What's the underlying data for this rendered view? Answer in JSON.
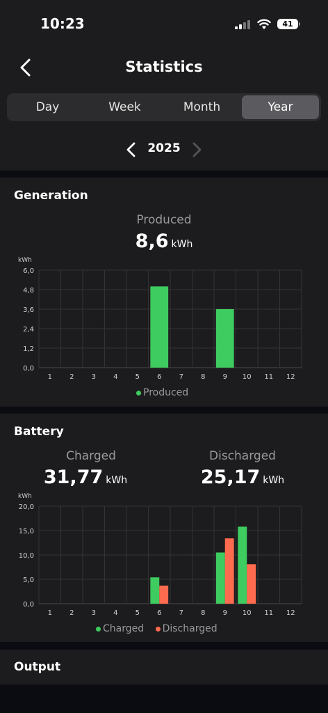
{
  "status_bar": {
    "time": "10:23",
    "battery": "41"
  },
  "header": {
    "title": "Statistics"
  },
  "tabs": [
    {
      "label": "Day",
      "active": false
    },
    {
      "label": "Week",
      "active": false
    },
    {
      "label": "Month",
      "active": false
    },
    {
      "label": "Year",
      "active": true
    }
  ],
  "period": {
    "label": "2025"
  },
  "generation": {
    "title": "Generation",
    "stat_label": "Produced",
    "stat_value": "8,6",
    "stat_unit": "kWh",
    "legend": "Produced"
  },
  "battery": {
    "title": "Battery",
    "charged_label": "Charged",
    "charged_value": "31,77",
    "charged_unit": "kWh",
    "discharged_label": "Discharged",
    "discharged_value": "25,17",
    "discharged_unit": "kWh",
    "legend_charged": "Charged",
    "legend_discharged": "Discharged"
  },
  "output": {
    "title": "Output"
  },
  "colors": {
    "green": "#3ecb5f",
    "red": "#ff6b4f",
    "background": "#1c1c1e"
  },
  "chart_data": [
    {
      "type": "bar",
      "ylabel": "kWh",
      "categories": [
        "1",
        "2",
        "3",
        "4",
        "5",
        "6",
        "7",
        "8",
        "9",
        "10",
        "11",
        "12"
      ],
      "ylim": [
        0,
        6
      ],
      "yticks": [
        "0,0",
        "1,2",
        "2,4",
        "3,6",
        "4,8",
        "6,0"
      ],
      "grid": true,
      "legend_position": "bottom",
      "series": [
        {
          "name": "Produced",
          "color": "#3ecb5f",
          "values": [
            0,
            0,
            0,
            0,
            0,
            5.0,
            0,
            0,
            3.6,
            0,
            0,
            0
          ]
        }
      ]
    },
    {
      "type": "bar",
      "ylabel": "kWh",
      "categories": [
        "1",
        "2",
        "3",
        "4",
        "5",
        "6",
        "7",
        "8",
        "9",
        "10",
        "11",
        "12"
      ],
      "ylim": [
        0,
        20
      ],
      "yticks": [
        "0,0",
        "5,0",
        "10,0",
        "15,0",
        "20,0"
      ],
      "grid": true,
      "legend_position": "bottom",
      "series": [
        {
          "name": "Charged",
          "color": "#3ecb5f",
          "values": [
            0,
            0,
            0,
            0,
            0,
            5.4,
            0,
            0,
            10.5,
            15.8,
            0,
            0
          ]
        },
        {
          "name": "Discharged",
          "color": "#ff6b4f",
          "values": [
            0,
            0,
            0,
            0,
            0,
            3.7,
            0,
            0,
            13.4,
            8.1,
            0,
            0
          ]
        }
      ]
    }
  ]
}
